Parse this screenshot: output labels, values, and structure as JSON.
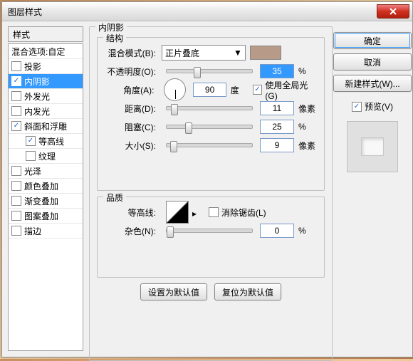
{
  "window": {
    "title": "图层样式"
  },
  "sidebar": {
    "header": "样式",
    "blend_options": "混合选项:自定",
    "items": [
      {
        "label": "投影",
        "checked": false,
        "selected": false,
        "indent": 0
      },
      {
        "label": "内阴影",
        "checked": true,
        "selected": true,
        "indent": 0
      },
      {
        "label": "外发光",
        "checked": false,
        "selected": false,
        "indent": 0
      },
      {
        "label": "内发光",
        "checked": false,
        "selected": false,
        "indent": 0
      },
      {
        "label": "斜面和浮雕",
        "checked": true,
        "selected": false,
        "indent": 0
      },
      {
        "label": "等高线",
        "checked": true,
        "selected": false,
        "indent": 1
      },
      {
        "label": "纹理",
        "checked": false,
        "selected": false,
        "indent": 1
      },
      {
        "label": "光泽",
        "checked": false,
        "selected": false,
        "indent": 0
      },
      {
        "label": "颜色叠加",
        "checked": false,
        "selected": false,
        "indent": 0
      },
      {
        "label": "渐变叠加",
        "checked": false,
        "selected": false,
        "indent": 0
      },
      {
        "label": "图案叠加",
        "checked": false,
        "selected": false,
        "indent": 0
      },
      {
        "label": "描边",
        "checked": false,
        "selected": false,
        "indent": 0
      }
    ]
  },
  "main": {
    "title": "内阴影",
    "structure": {
      "legend": "结构",
      "blend_mode_label": "混合模式(B):",
      "blend_mode_value": "正片叠底",
      "color": "#b89a88",
      "opacity_label": "不透明度(O):",
      "opacity_value": "35",
      "opacity_unit": "%",
      "angle_label": "角度(A):",
      "angle_value": "90",
      "angle_unit": "度",
      "global_light_label": "使用全局光(G)",
      "global_light_checked": true,
      "distance_label": "距离(D):",
      "distance_value": "11",
      "distance_unit": "像素",
      "choke_label": "阻塞(C):",
      "choke_value": "25",
      "choke_unit": "%",
      "size_label": "大小(S):",
      "size_value": "9",
      "size_unit": "像素"
    },
    "quality": {
      "legend": "品质",
      "contour_label": "等高线:",
      "antialias_label": "消除锯齿(L)",
      "antialias_checked": false,
      "noise_label": "杂色(N):",
      "noise_value": "0",
      "noise_unit": "%"
    },
    "buttons": {
      "make_default": "设置为默认值",
      "reset_default": "复位为默认值"
    }
  },
  "right": {
    "ok": "确定",
    "cancel": "取消",
    "new_style": "新建样式(W)...",
    "preview_label": "预览(V)",
    "preview_checked": true
  }
}
